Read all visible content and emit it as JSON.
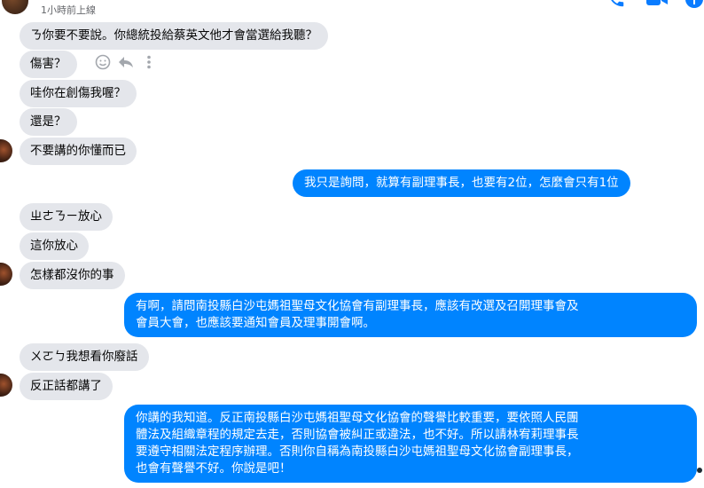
{
  "header": {
    "contact_name": "",
    "status": "1小時前上線",
    "colors": {
      "accent": "#0a7cff"
    },
    "icons": [
      "phone-icon",
      "video-icon",
      "info-icon"
    ]
  },
  "messages": [
    {
      "direction": "in",
      "text": "ㄋ你要不要說。你總統投給蔡英文他才會當選給我聽？"
    },
    {
      "direction": "in",
      "text": "傷害？"
    },
    {
      "direction": "in",
      "text": "哇你在創傷我喔？"
    },
    {
      "direction": "in",
      "text": "還是？"
    },
    {
      "direction": "in",
      "text": "不要講的你懂而已"
    },
    {
      "direction": "out",
      "text": "我只是詢問，就算有副理事長，也要有2位，怎麼會只有1位"
    },
    {
      "direction": "in",
      "text": "ㄓㄜㄋㄧ放心"
    },
    {
      "direction": "in",
      "text": "這你放心"
    },
    {
      "direction": "in",
      "text": "怎樣都沒你的事"
    },
    {
      "direction": "out",
      "lines": [
        "有啊，請問南投縣白沙屯媽祖聖母文化協會有副理事長，應該有改選及召開理事會及",
        "會員大會，也應該要通知會員及理事開會啊。"
      ]
    },
    {
      "direction": "in",
      "text": "ㄨㄛㄅ我想看你廢話"
    },
    {
      "direction": "in",
      "text": "反正話都講了"
    },
    {
      "direction": "out",
      "lines": [
        "你講的我知道。反正南投縣白沙屯媽祖聖母文化協會的聲譽比較重要，要依照人民團",
        "體法及組織章程的規定去走，否則協會被糾正或違法，也不好。所以請林宥莉理事長",
        "要遵守相關法定程序辦理。否則你自稱為南投縣白沙屯媽祖聖母文化協會副理事長，",
        "也會有聲譽不好。你說是吧！"
      ]
    }
  ],
  "hover_actions": [
    "emoji-icon",
    "reply-icon",
    "more-icon"
  ],
  "theme": {
    "incoming_bg": "#e4e6eb",
    "outgoing_bg": "#0084ff"
  }
}
